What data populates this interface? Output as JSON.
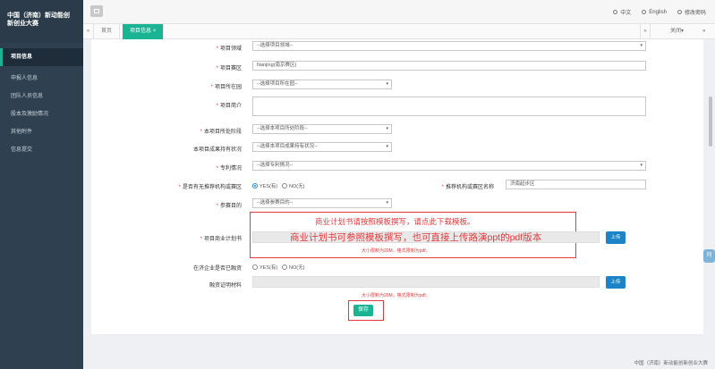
{
  "sidebar": {
    "brand_line1": "中国（济南）新动能创",
    "brand_line2": "新创业大赛",
    "items": [
      {
        "label": "项目信息",
        "active": true
      },
      {
        "label": "申报人信息"
      },
      {
        "label": "团队人员信息"
      },
      {
        "label": "股本及激励情况"
      },
      {
        "label": "其他附件"
      },
      {
        "label": "信息提交"
      }
    ]
  },
  "topbar": {
    "lang_cn": "中文",
    "lang_en": "English",
    "change_password": "修改密码"
  },
  "tabs": {
    "prev": "«",
    "home": "首页",
    "current": "项目信息",
    "current_close": "×",
    "next": "»",
    "close_menu": "关闭▾",
    "right_arrow": "»"
  },
  "form": {
    "field": {
      "label": "项目领域",
      "placeholder": "--选择项目领域--"
    },
    "region": {
      "label": "项目赛区",
      "value": "Nanjing(南京赛区)"
    },
    "location": {
      "label": "项目所在园",
      "placeholder": "--选择项目所在园--"
    },
    "intro": {
      "label": "项目简介"
    },
    "stage": {
      "label": "本项目所处阶段",
      "placeholder": "--选择本项目所处阶段--"
    },
    "holding": {
      "label": "本项目成果持有状况",
      "placeholder": "--选择本项目成果持有状况--"
    },
    "patent": {
      "label": "专利情况",
      "placeholder": "--选择专利情况--"
    },
    "recommend": {
      "label": "是否有无推荐机构或赛区",
      "yes": "YES(有)",
      "no": "NO(无)",
      "org_label": "推荐机构或赛区名称",
      "org_value": "济南起步区"
    },
    "purpose": {
      "label": "参赛目的",
      "placeholder": "--选择参赛目的--"
    },
    "bp": {
      "label": "项目商业计划书",
      "red_title": "商业计划书请按照模板撰写，请点此下载模板。",
      "red_big": "商业计划书可参照模板撰写，也可直接上传路演ppt的pdf版本",
      "hint": "大小限制为20M，格式限制为pdf。",
      "upload": "上传"
    },
    "financing": {
      "label": "在济企业是否已融资",
      "yes": "YES(有)",
      "no": "NO(无)"
    },
    "proof": {
      "label": "融资证明材料",
      "hint": "大小限制为20M，格式限制为pdf。",
      "upload": "上传"
    },
    "save": "保存"
  },
  "float_icon": "问",
  "footer": "中国（济南）新动能创新创业大赛"
}
